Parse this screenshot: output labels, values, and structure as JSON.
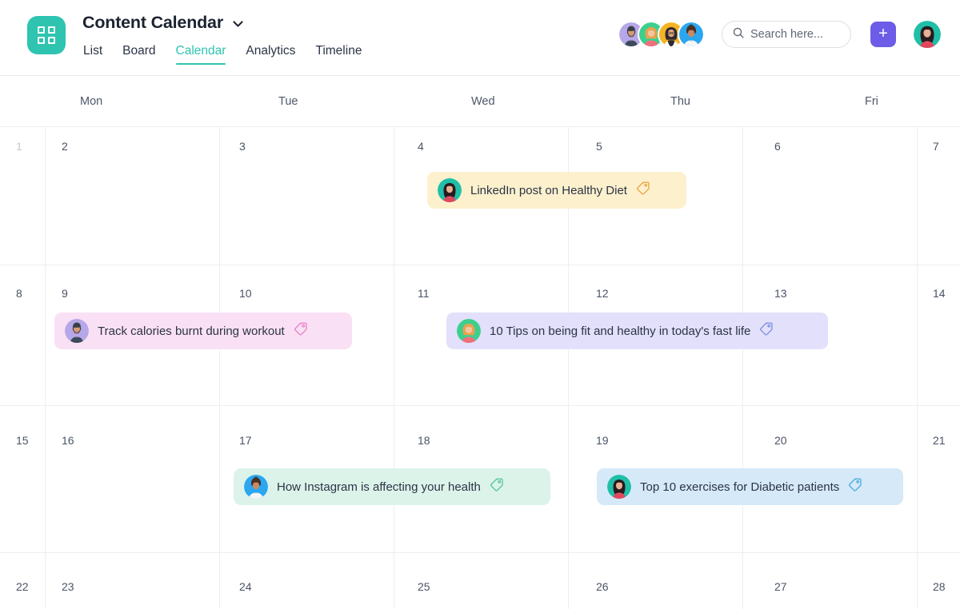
{
  "header": {
    "logo_icon": "grid-squares-icon",
    "logo_color": "#2ec4b0",
    "title": "Content Calendar",
    "title_dropdown_icon": "chevron-down-icon",
    "tabs": [
      {
        "label": "List",
        "active": false
      },
      {
        "label": "Board",
        "active": false
      },
      {
        "label": "Calendar",
        "active": true
      },
      {
        "label": "Analytics",
        "active": false
      },
      {
        "label": "Timeline",
        "active": false
      }
    ],
    "active_tab_color": "#2ec4b0",
    "members": [
      {
        "name": "member-avatar-1",
        "bg": "#b6a8e8"
      },
      {
        "name": "member-avatar-2",
        "bg": "#3ecf8e"
      },
      {
        "name": "member-avatar-3",
        "bg": "#f5b425"
      },
      {
        "name": "member-avatar-4",
        "bg": "#2ba6f0"
      }
    ],
    "search": {
      "icon": "search-icon",
      "placeholder": "Search here...",
      "value": ""
    },
    "add_button": {
      "icon": "plus-icon",
      "label": "+",
      "color": "#6c5ce7"
    },
    "current_user_avatar": {
      "name": "current-user-avatar",
      "bg": "#1fbfa8"
    }
  },
  "calendar": {
    "weekday_headers": [
      "Mon",
      "Tue",
      "Wed",
      "Thu",
      "Fri"
    ],
    "weeks": [
      {
        "days": [
          {
            "num": "1",
            "muted": true
          },
          {
            "num": "2",
            "muted": false
          },
          {
            "num": "3",
            "muted": false
          },
          {
            "num": "4",
            "muted": false
          },
          {
            "num": "5",
            "muted": false
          },
          {
            "num": "6",
            "muted": false
          },
          {
            "num": "7",
            "muted": false
          }
        ]
      },
      {
        "days": [
          {
            "num": "8",
            "muted": false
          },
          {
            "num": "9",
            "muted": false
          },
          {
            "num": "10",
            "muted": false
          },
          {
            "num": "11",
            "muted": false
          },
          {
            "num": "12",
            "muted": false
          },
          {
            "num": "13",
            "muted": false
          },
          {
            "num": "14",
            "muted": false
          }
        ]
      },
      {
        "days": [
          {
            "num": "15",
            "muted": false
          },
          {
            "num": "16",
            "muted": false
          },
          {
            "num": "17",
            "muted": false
          },
          {
            "num": "18",
            "muted": false
          },
          {
            "num": "19",
            "muted": false
          },
          {
            "num": "20",
            "muted": false
          },
          {
            "num": "21",
            "muted": false
          }
        ]
      },
      {
        "days": [
          {
            "num": "22",
            "muted": false
          },
          {
            "num": "23",
            "muted": false
          },
          {
            "num": "24",
            "muted": false
          },
          {
            "num": "25",
            "muted": false
          },
          {
            "num": "26",
            "muted": false
          },
          {
            "num": "27",
            "muted": false
          },
          {
            "num": "28",
            "muted": false
          }
        ]
      }
    ],
    "events": [
      {
        "title": "LinkedIn post on Healthy Diet",
        "bg": "#fdf0cd",
        "tag_icon": "tag-icon",
        "tag_color": "#e8a33d",
        "avatar_bg": "#1fbfa8",
        "avatar_name": "event-avatar-linkedin-post"
      },
      {
        "title": "Track calories burnt during workout",
        "bg": "#fae0f4",
        "tag_icon": "tag-icon",
        "tag_color": "#e87cc8",
        "avatar_bg": "#b6a8e8",
        "avatar_name": "event-avatar-track-calories"
      },
      {
        "title": "10 Tips on being fit and healthy in today's fast life",
        "bg": "#e2e0fa",
        "tag_icon": "tag-icon",
        "tag_color": "#7b8ce0",
        "avatar_bg": "#3ecf8e",
        "avatar_name": "event-avatar-10-tips"
      },
      {
        "title": "How Instagram is affecting your health",
        "bg": "#dcf3ea",
        "tag_icon": "tag-icon",
        "tag_color": "#4fc39b",
        "avatar_bg": "#2ba6f0",
        "avatar_name": "event-avatar-how-instagram"
      },
      {
        "title": "Top 10 exercises for Diabetic patients",
        "bg": "#d5e9f8",
        "tag_icon": "tag-icon",
        "tag_color": "#49a7e0",
        "avatar_bg": "#1fbfa8",
        "avatar_name": "event-avatar-top-10-exercises"
      }
    ]
  }
}
